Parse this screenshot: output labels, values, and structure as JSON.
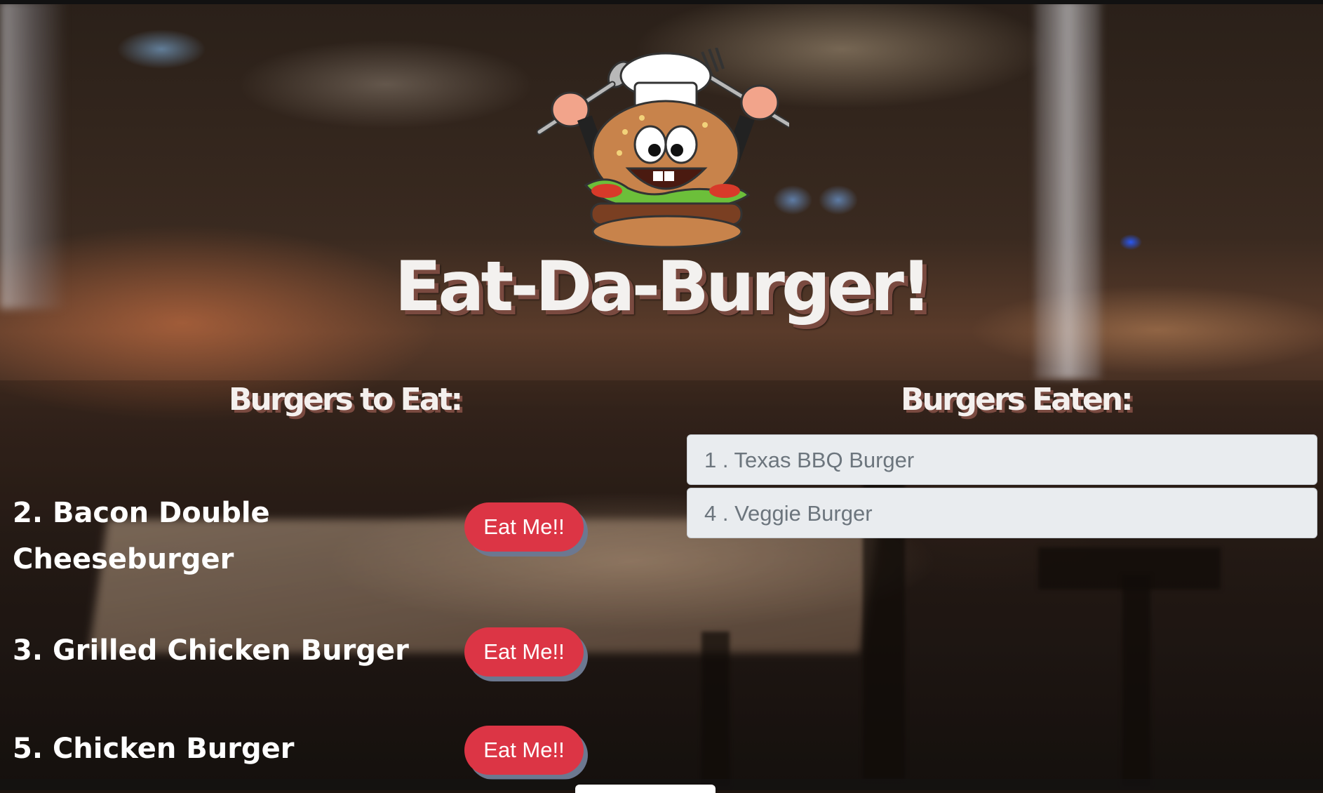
{
  "header": {
    "title": "Eat-Da-Burger!",
    "logo_icon": "cartoon-burger-chef-icon"
  },
  "columns": {
    "to_eat_heading": "Burgers to Eat:",
    "eaten_heading": "Burgers Eaten:"
  },
  "burgers_to_eat": [
    {
      "name": "2. Bacon Double Cheeseburger",
      "button": "Eat Me!!"
    },
    {
      "name": "3. Grilled Chicken Burger",
      "button": "Eat Me!!"
    },
    {
      "name": "5. Chicken Burger",
      "button": "Eat Me!!"
    }
  ],
  "burgers_eaten": [
    {
      "label": "1 . Texas BBQ Burger"
    },
    {
      "label": "4 . Veggie Burger"
    }
  ],
  "colors": {
    "button": "#dc3545",
    "button_shadow": "#6c7890",
    "list_item_bg": "#e9ecef",
    "list_item_text": "#6c757d",
    "title_shadow": "#7a4a40"
  }
}
